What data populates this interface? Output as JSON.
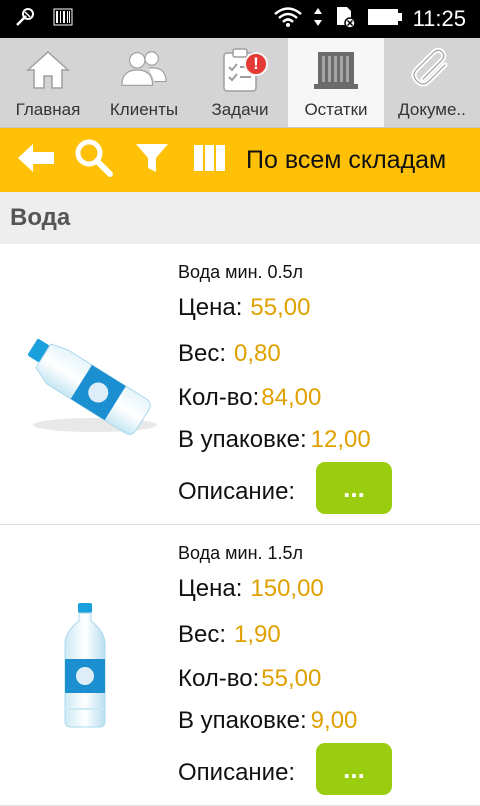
{
  "statusbar": {
    "time": "11:25",
    "icons": [
      "usb-debug-icon",
      "barcode-icon",
      "wifi-icon",
      "sim-no-service-icon",
      "battery-icon"
    ]
  },
  "tabs": [
    {
      "label": "Главная",
      "icon": "home-icon",
      "active": false
    },
    {
      "label": "Клиенты",
      "icon": "clients-icon",
      "active": false
    },
    {
      "label": "Задачи",
      "icon": "tasks-icon",
      "active": false,
      "badge": "!"
    },
    {
      "label": "Остатки",
      "icon": "warehouse-icon",
      "active": true
    },
    {
      "label": "Докуме..",
      "icon": "paperclip-icon",
      "active": false
    }
  ],
  "toolbar": {
    "title": "По всем складам",
    "icons": [
      "back-arrow-icon",
      "search-icon",
      "filter-icon",
      "columns-icon"
    ],
    "accent": "#ffc107"
  },
  "section": {
    "title": "Вода"
  },
  "products": [
    {
      "name": "Вода мин. 0.5л",
      "price_label": "Цена:",
      "price": "55,00",
      "weight_label": "Вес:",
      "weight": "0,80",
      "qty_label": "Кол-во:",
      "qty": "84,00",
      "pack_label": "В упаковке:",
      "pack": "12,00",
      "desc_label": "Описание:",
      "desc_button": "..."
    },
    {
      "name": "Вода мин. 1.5л",
      "price_label": "Цена:",
      "price": "150,00",
      "weight_label": "Вес:",
      "weight": "1,90",
      "qty_label": "Кол-во:",
      "qty": "55,00",
      "pack_label": "В упаковке:",
      "pack": "9,00",
      "desc_label": "Описание:",
      "desc_button": "..."
    }
  ],
  "colors": {
    "value": "#e0a000",
    "desc_button": "#9acd0f",
    "badge": "#e53935"
  }
}
